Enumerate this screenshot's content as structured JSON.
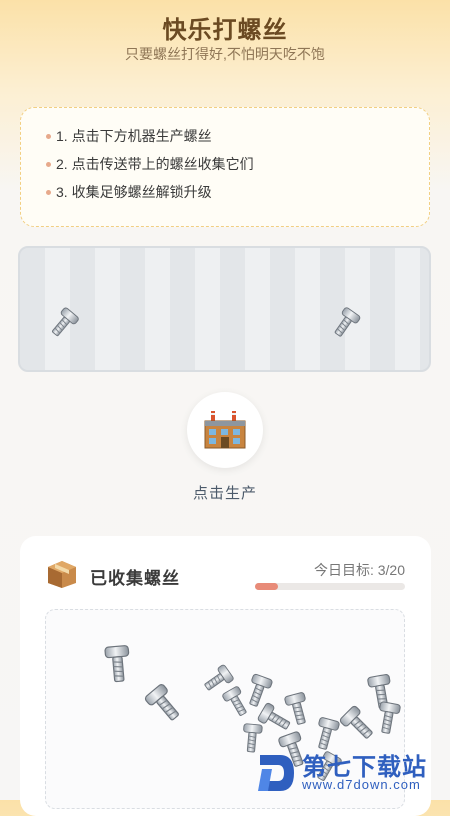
{
  "header": {
    "title": "快乐打螺丝",
    "subtitle": "只要螺丝打得好,不怕明天吃不饱"
  },
  "instructions": [
    "1. 点击下方机器生产螺丝",
    "2. 点击传送带上的螺丝收集它们",
    "3. 收集足够螺丝解锁升级"
  ],
  "produce": {
    "icon": "factory-icon",
    "label": "点击生产"
  },
  "collected": {
    "icon": "package-icon",
    "title": "已收集螺丝",
    "goal_text": "今日目标: 3/20",
    "goal_current": 3,
    "goal_target": 20
  },
  "watermark": {
    "name": "第七下载站",
    "url": "www.d7down.com"
  },
  "colors": {
    "title": "#6b4a22",
    "accent_dash": "#f2cf82",
    "progress_fill": "#e88b78",
    "watermark": "#2f5fbf"
  }
}
